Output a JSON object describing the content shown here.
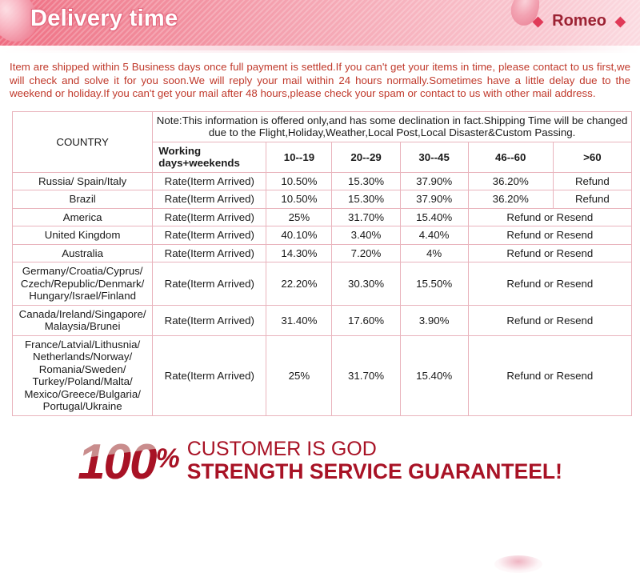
{
  "header": {
    "title": "Delivery time",
    "brand": "Romeo",
    "diamond_left": "◆",
    "diamond_right": "◆"
  },
  "intro": {
    "text": "Item are shipped within 5 Business days once full payment is settled.If you can't get your items in time, please contact to us first,we will check and solve it for you soon.We will reply your mail within 24 hours normally.Sometimes have a little delay due to the weekend or holiday.If you can't get your mail after 48 hours,please check your spam or contact to us with other mail address."
  },
  "table": {
    "country_header": "COUNTRY",
    "note": "Note:This information is offered only,and has some declination in fact.Shipping Time will be changed due to the Flight,Holiday,Weather,Local Post,Local Disaster&Custom Passing.",
    "subheaders": {
      "working": "Working\ndays+weekends",
      "working_line1": "Working",
      "working_line2": "days+weekends",
      "r1": "10--19",
      "r2": "20--29",
      "r3": "30--45",
      "r4": "46--60",
      "r5": ">60"
    },
    "rows": [
      {
        "country": "Russia/ Spain/Italy",
        "country_color": "red",
        "rate": "Rate(Iterm Arrived)",
        "v1": "10.50%",
        "v2": "15.30%",
        "v3": "37.90%",
        "v4": "36.20%",
        "v5": "Refund",
        "merged_tail": false
      },
      {
        "country": "Brazil",
        "country_color": "red",
        "rate": "Rate(Iterm Arrived)",
        "v1": "10.50%",
        "v2": "15.30%",
        "v3": "37.90%",
        "v4": "36.20%",
        "v5": "Refund",
        "merged_tail": false
      },
      {
        "country": "America",
        "country_color": "red",
        "rate": "Rate(Iterm Arrived)",
        "v1": "25%",
        "v2": "31.70%",
        "v3": "15.40%",
        "tail": "Refund or Resend",
        "merged_tail": true
      },
      {
        "country": "United Kingdom",
        "country_color": "black",
        "rate": "Rate(Iterm Arrived)",
        "v1": "40.10%",
        "v2": "3.40%",
        "v3": "4.40%",
        "tail": "Refund or Resend",
        "merged_tail": true
      },
      {
        "country": "Australia",
        "country_color": "black",
        "rate": "Rate(Iterm Arrived)",
        "v1": "14.30%",
        "v2": "7.20%",
        "v3": "4%",
        "tail": "Refund or Resend",
        "merged_tail": true
      },
      {
        "country": "Germany/Croatia/Cyprus/\nCzech/Republic/Denmark/\nHungary/Israel/Finland",
        "country_color": "black",
        "rate": "Rate(Iterm Arrived)",
        "v1": "22.20%",
        "v2": "30.30%",
        "v3": "15.50%",
        "tail": "Refund or Resend",
        "merged_tail": true
      },
      {
        "country": "Canada/Ireland/Singapore/\nMalaysia/Brunei",
        "country_color": "black",
        "rate": "Rate(Iterm Arrived)",
        "v1": "31.40%",
        "v2": "17.60%",
        "v3": "3.90%",
        "tail": "Refund or Resend",
        "merged_tail": true
      },
      {
        "country": "France/Latvial/Lithusnia/\nNetherlands/Norway/\nRomania/Sweden/\nTurkey/Poland/Malta/\nMexico/Greece/Bulgaria/\nPortugal/Ukraine",
        "country_color": "black",
        "rate": "Rate(Iterm Arrived)",
        "v1": "25%",
        "v2": "31.70%",
        "v3": "15.40%",
        "tail": "Refund or Resend",
        "merged_tail": true
      }
    ]
  },
  "guarantee": {
    "number": "100",
    "percent": "%",
    "line1": "CUSTOMER IS GOD",
    "line2": "STRENGTH SERVICE GUARANTEEL!"
  },
  "colors": {
    "banner_pink_dark": "#ef6d82",
    "banner_pink_light": "#fbdbe1",
    "intro_red": "#c0392b",
    "table_border": "#e9b4bd",
    "subhead_red": "#b52d22",
    "guarantee_dark_red": "#a81225",
    "guarantee_light_red": "#c98d8d"
  }
}
